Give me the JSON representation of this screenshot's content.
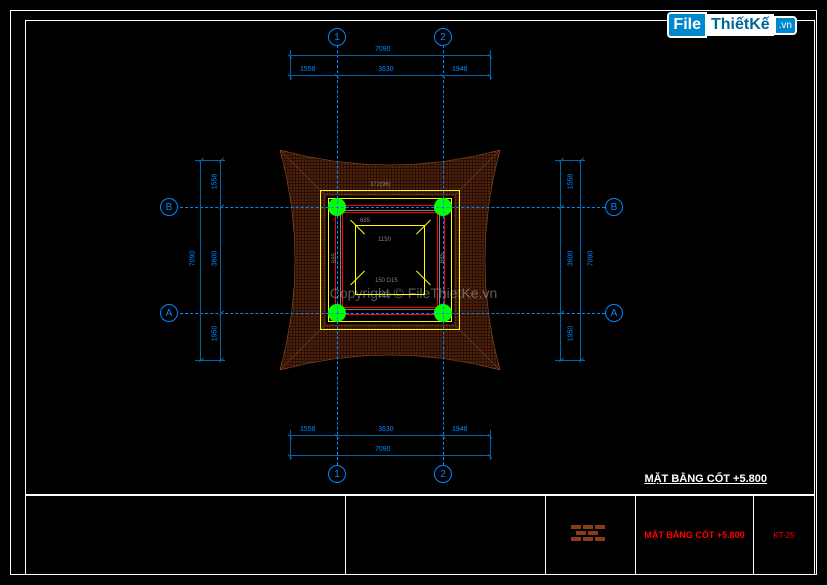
{
  "logo": {
    "part1": "File",
    "part2": "ThiếtKế",
    "part3": ".vn"
  },
  "copyright": "Copyright © FileThietKe.vn",
  "drawing_title": "MẶT BẰNG CỐT +5.800",
  "titleblock": {
    "drawing_name": "MẶT BẰNG CỐT +5.800",
    "sheet": "KT-25"
  },
  "grids": {
    "vertical": [
      {
        "id": "1",
        "label": "1"
      },
      {
        "id": "2",
        "label": "2"
      }
    ],
    "horizontal": [
      {
        "id": "A",
        "label": "A"
      },
      {
        "id": "B",
        "label": "B"
      }
    ]
  },
  "dimensions": {
    "overall_h": "7090",
    "side_h_left": "1558",
    "side_h_mid": "3630",
    "side_h_right": "1948",
    "overall_v": "7090",
    "side_v_top": "1558",
    "side_v_mid": "3600",
    "side_v_bot": "1950",
    "inner_dim_small1": "260",
    "inner_dim_small2": "685",
    "inner_dim_mid": "1150",
    "inner_dim_sub": "150 D15",
    "inner_3720": "372(96)"
  },
  "colors": {
    "roof_fill": "#4a1f10",
    "grid": "#0088ff",
    "dim": "#0066aa",
    "column": "#00ff00",
    "line_yellow": "#ffff00"
  }
}
